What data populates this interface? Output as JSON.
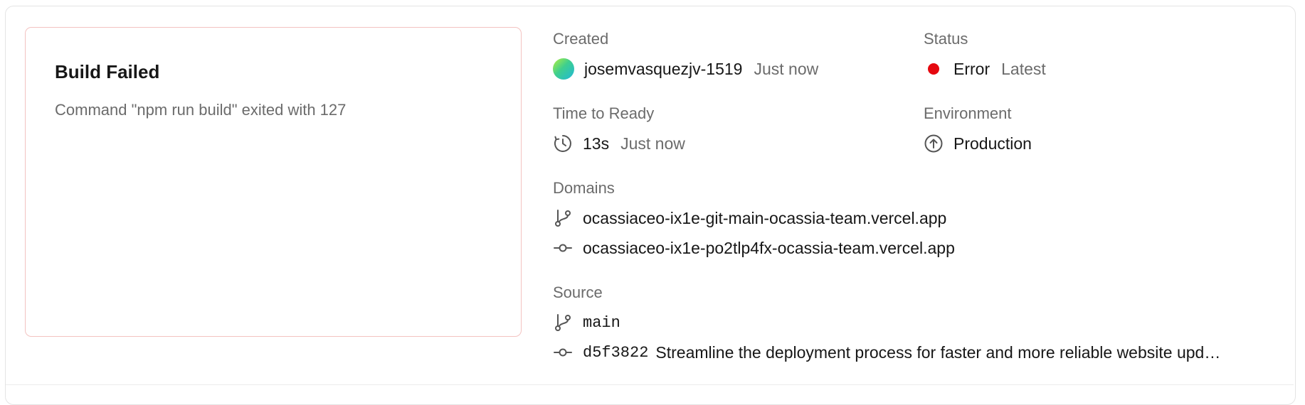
{
  "error_card": {
    "title": "Build Failed",
    "message": "Command \"npm run build\" exited with 127"
  },
  "created": {
    "label": "Created",
    "user": "josemvasquezjv-1519",
    "time": "Just now"
  },
  "status": {
    "label": "Status",
    "value": "Error",
    "tag": "Latest",
    "color": "#e5080f"
  },
  "time_to_ready": {
    "label": "Time to Ready",
    "duration": "13s",
    "time": "Just now"
  },
  "environment": {
    "label": "Environment",
    "value": "Production"
  },
  "domains": {
    "label": "Domains",
    "items": [
      {
        "icon": "git-branch-icon",
        "url": "ocassiaceo-ix1e-git-main-ocassia-team.vercel.app"
      },
      {
        "icon": "git-commit-icon",
        "url": "ocassiaceo-ix1e-po2tlp4fx-ocassia-team.vercel.app"
      }
    ]
  },
  "source": {
    "label": "Source",
    "branch": "main",
    "commit_hash": "d5f3822",
    "commit_message": "Streamline the deployment process for faster and more reliable website upd…"
  }
}
